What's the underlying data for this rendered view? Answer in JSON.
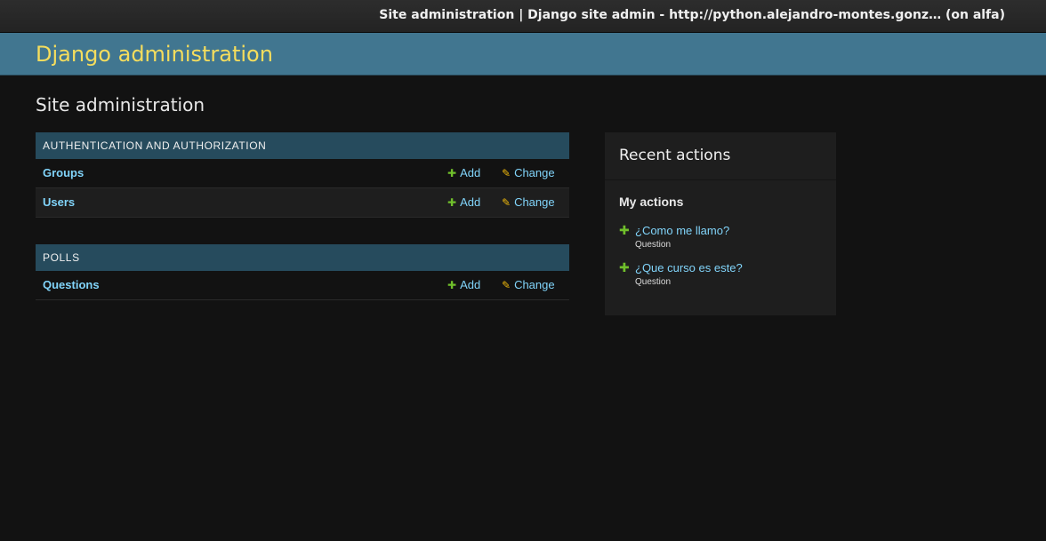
{
  "window": {
    "title": "Site administration | Django site admin - http://python.alejandro-montes.gonz… (on alfa)"
  },
  "header": {
    "branding": "Django administration"
  },
  "content": {
    "title": "Site administration"
  },
  "modules": [
    {
      "caption": "Authentication and Authorization",
      "models": [
        {
          "name": "Groups",
          "add_label": "Add",
          "change_label": "Change"
        },
        {
          "name": "Users",
          "add_label": "Add",
          "change_label": "Change"
        }
      ]
    },
    {
      "caption": "Polls",
      "models": [
        {
          "name": "Questions",
          "add_label": "Add",
          "change_label": "Change"
        }
      ]
    }
  ],
  "icons": {
    "add": "plus-icon",
    "change": "pencil-icon"
  },
  "recent_actions": {
    "title": "Recent actions",
    "subtitle": "My actions",
    "items": [
      {
        "label": "¿Como me llamo?",
        "type": "Question",
        "icon": "addlink-icon"
      },
      {
        "label": "¿Que curso es este?",
        "type": "Question",
        "icon": "addlink-icon"
      }
    ]
  },
  "colors": {
    "header_bg": "#417690",
    "branding": "#f5dd5d",
    "module_caption_bg": "#264b5d",
    "link": "#81d4fa",
    "add_icon": "#70bf2b",
    "change_icon": "#efb80b",
    "page_bg": "#121212"
  }
}
